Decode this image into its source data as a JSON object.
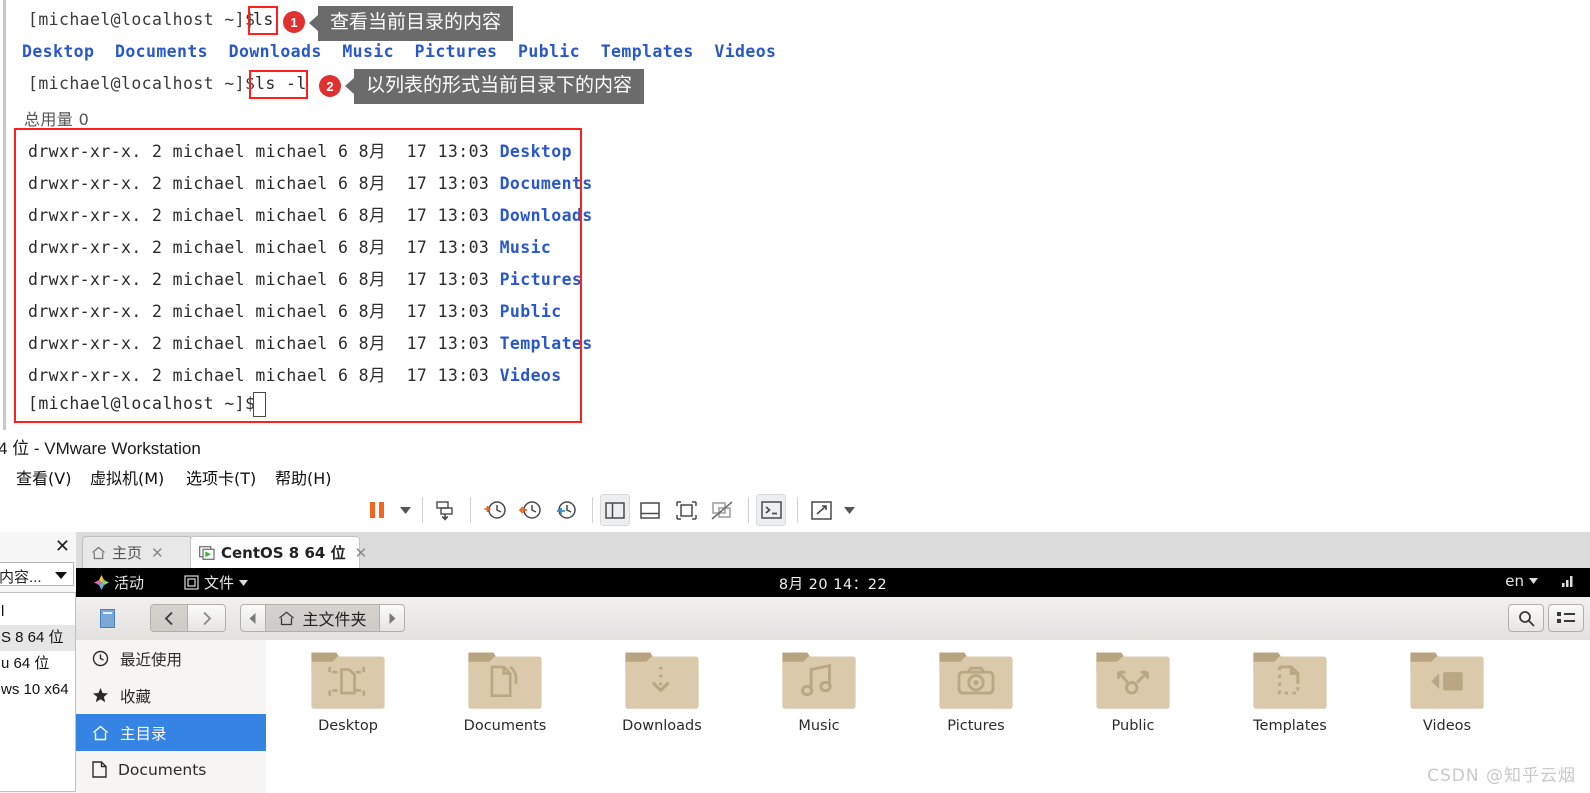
{
  "terminal": {
    "prompt": "[michael@localhost ~]$ ",
    "cmd1": "ls",
    "cmd2": "ls -l",
    "ls_output_dirs": [
      "Desktop",
      "Documents",
      "Downloads",
      "Music",
      "Pictures",
      "Public",
      "Templates",
      "Videos"
    ],
    "total_line": "总用量 0",
    "listing": [
      {
        "perms": "drwxr-xr-x.",
        "links": "2",
        "owner": "michael",
        "group": "michael",
        "size": "6",
        "month": "8月",
        "day": "17",
        "time": "13:03",
        "name": "Desktop"
      },
      {
        "perms": "drwxr-xr-x.",
        "links": "2",
        "owner": "michael",
        "group": "michael",
        "size": "6",
        "month": "8月",
        "day": "17",
        "time": "13:03",
        "name": "Documents"
      },
      {
        "perms": "drwxr-xr-x.",
        "links": "2",
        "owner": "michael",
        "group": "michael",
        "size": "6",
        "month": "8月",
        "day": "17",
        "time": "13:03",
        "name": "Downloads"
      },
      {
        "perms": "drwxr-xr-x.",
        "links": "2",
        "owner": "michael",
        "group": "michael",
        "size": "6",
        "month": "8月",
        "day": "17",
        "time": "13:03",
        "name": "Music"
      },
      {
        "perms": "drwxr-xr-x.",
        "links": "2",
        "owner": "michael",
        "group": "michael",
        "size": "6",
        "month": "8月",
        "day": "17",
        "time": "13:03",
        "name": "Pictures"
      },
      {
        "perms": "drwxr-xr-x.",
        "links": "2",
        "owner": "michael",
        "group": "michael",
        "size": "6",
        "month": "8月",
        "day": "17",
        "time": "13:03",
        "name": "Public"
      },
      {
        "perms": "drwxr-xr-x.",
        "links": "2",
        "owner": "michael",
        "group": "michael",
        "size": "6",
        "month": "8月",
        "day": "17",
        "time": "13:03",
        "name": "Templates"
      },
      {
        "perms": "drwxr-xr-x.",
        "links": "2",
        "owner": "michael",
        "group": "michael",
        "size": "6",
        "month": "8月",
        "day": "17",
        "time": "13:03",
        "name": "Videos"
      }
    ],
    "callouts": [
      {
        "number": "1",
        "text": "查看当前目录的内容"
      },
      {
        "number": "2",
        "text": "以列表的形式当前目录下的内容"
      }
    ],
    "accent_red": "#ff1f1f",
    "dir_blue": "#2a58c8",
    "callout_bg": "#6b6b6b",
    "callout_badge": "#e03030"
  },
  "vmware": {
    "title": "4 位 - VMware Workstation",
    "menus": [
      "查看(V)",
      "虚拟机(M)",
      "选项卡(T)",
      "帮助(H)"
    ],
    "toolbar_icons": [
      "pause-icon",
      "dropdown-caret-icon",
      "send-ctrl-alt-del-icon",
      "take-snapshot-icon",
      "revert-snapshot-icon",
      "manage-snapshots-icon",
      "show-library-icon",
      "show-thumbnails-icon",
      "fullscreen-icon",
      "unity-icon",
      "console-view-icon",
      "stretch-icon",
      "stretch-caret-icon"
    ],
    "library": {
      "close_label": "✕",
      "search_value": "内容...",
      "items": [
        "l",
        "S 8 64 位",
        "u 64 位",
        "ws 10 x64"
      ],
      "selected_index": 1
    },
    "tabs": [
      {
        "label": "主页",
        "icon": "home-icon",
        "active": false,
        "close": "✕"
      },
      {
        "label": "CentOS 8 64 位",
        "icon": "vm-power-icon",
        "active": true,
        "close": "✕"
      }
    ]
  },
  "guest": {
    "topbar": {
      "activities": "活动",
      "app_menu": "文件",
      "clock": "8月 20  14：22",
      "keyboard": "en"
    },
    "files": {
      "breadcrumb": "主文件夹",
      "breadcrumb_icon": "home-icon",
      "back_icon": "chevron-left-icon",
      "forward_icon": "chevron-right-icon",
      "sidebar_toggle_icon": "sidebar-icon",
      "search_icon": "search-icon",
      "view_list_icon": "list-view-icon",
      "sidebar": [
        {
          "label": "最近使用",
          "icon": "clock-icon",
          "selected": false
        },
        {
          "label": "收藏",
          "icon": "star-icon",
          "selected": false
        },
        {
          "label": "主目录",
          "icon": "home-icon",
          "selected": true
        },
        {
          "label": "Documents",
          "icon": "document-icon",
          "selected": false
        }
      ],
      "folders": [
        {
          "name": "Desktop",
          "emblem": "desktop-emblem"
        },
        {
          "name": "Documents",
          "emblem": "documents-emblem"
        },
        {
          "name": "Downloads",
          "emblem": "downloads-emblem"
        },
        {
          "name": "Music",
          "emblem": "music-emblem"
        },
        {
          "name": "Pictures",
          "emblem": "pictures-emblem"
        },
        {
          "name": "Public",
          "emblem": "public-emblem"
        },
        {
          "name": "Templates",
          "emblem": "templates-emblem"
        },
        {
          "name": "Videos",
          "emblem": "videos-emblem"
        }
      ],
      "folder_color": "#dac9ab",
      "folder_tab_color": "#b8a480"
    }
  },
  "watermark": "CSDN @知乎云烟"
}
